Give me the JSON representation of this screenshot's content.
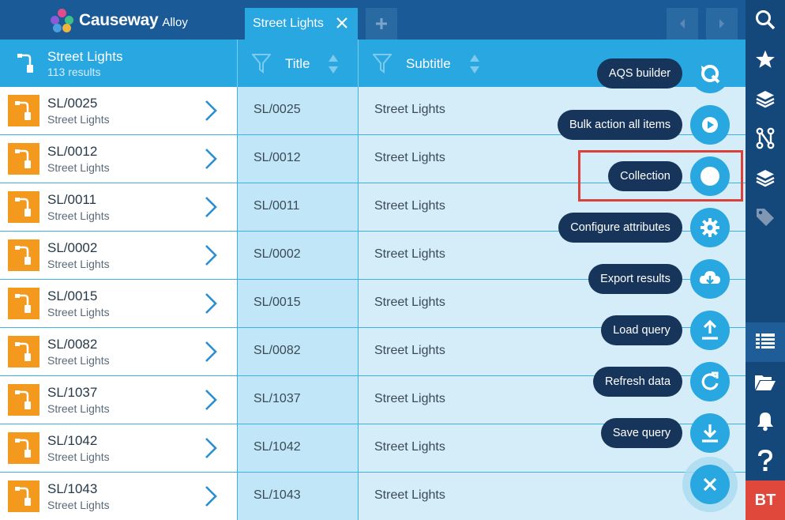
{
  "app": {
    "brand": "Causeway",
    "product": "Alloy",
    "active_tab": "Street Lights",
    "colors": {
      "topbar": "#1a5a96",
      "accent": "#29a7e1",
      "rail": "#14477a",
      "item_orange": "#f39a1e",
      "pill": "#17355a",
      "highlight": "#d9413a"
    }
  },
  "header": {
    "title": "Street Lights",
    "count": "113 results",
    "columns": [
      {
        "label": "Title"
      },
      {
        "label": "Subtitle"
      }
    ]
  },
  "rows": [
    {
      "code": "SL/0025",
      "type": "Street Lights",
      "title": "SL/0025",
      "subtitle": "Street Lights"
    },
    {
      "code": "SL/0012",
      "type": "Street Lights",
      "title": "SL/0012",
      "subtitle": "Street Lights"
    },
    {
      "code": "SL/0011",
      "type": "Street Lights",
      "title": "SL/0011",
      "subtitle": "Street Lights"
    },
    {
      "code": "SL/0002",
      "type": "Street Lights",
      "title": "SL/0002",
      "subtitle": "Street Lights"
    },
    {
      "code": "SL/0015",
      "type": "Street Lights",
      "title": "SL/0015",
      "subtitle": "Street Lights"
    },
    {
      "code": "SL/0082",
      "type": "Street Lights",
      "title": "SL/0082",
      "subtitle": "Street Lights"
    },
    {
      "code": "SL/1037",
      "type": "Street Lights",
      "title": "SL/1037",
      "subtitle": "Street Lights"
    },
    {
      "code": "SL/1042",
      "type": "Street Lights",
      "title": "SL/1042",
      "subtitle": "Street Lights"
    },
    {
      "code": "SL/1043",
      "type": "Street Lights",
      "title": "SL/1043",
      "subtitle": "Street Lights"
    }
  ],
  "fab_menu": [
    {
      "label": "AQS builder",
      "icon": "aqs-icon"
    },
    {
      "label": "Bulk action all items",
      "icon": "bulk-action-icon"
    },
    {
      "label": "Collection",
      "icon": "collection-icon"
    },
    {
      "label": "Configure attributes",
      "icon": "gear-icon"
    },
    {
      "label": "Export results",
      "icon": "cloud-download-icon"
    },
    {
      "label": "Load query",
      "icon": "upload-icon"
    },
    {
      "label": "Refresh data",
      "icon": "refresh-icon"
    },
    {
      "label": "Save query",
      "icon": "download-icon"
    }
  ],
  "rail": {
    "items": [
      "search-icon",
      "star-icon",
      "layers-icon",
      "workflow-icon",
      "layers-icon",
      "tag-icon",
      "list-icon",
      "folder-icon",
      "bell-icon",
      "help-icon"
    ],
    "user_initials": "BT"
  }
}
